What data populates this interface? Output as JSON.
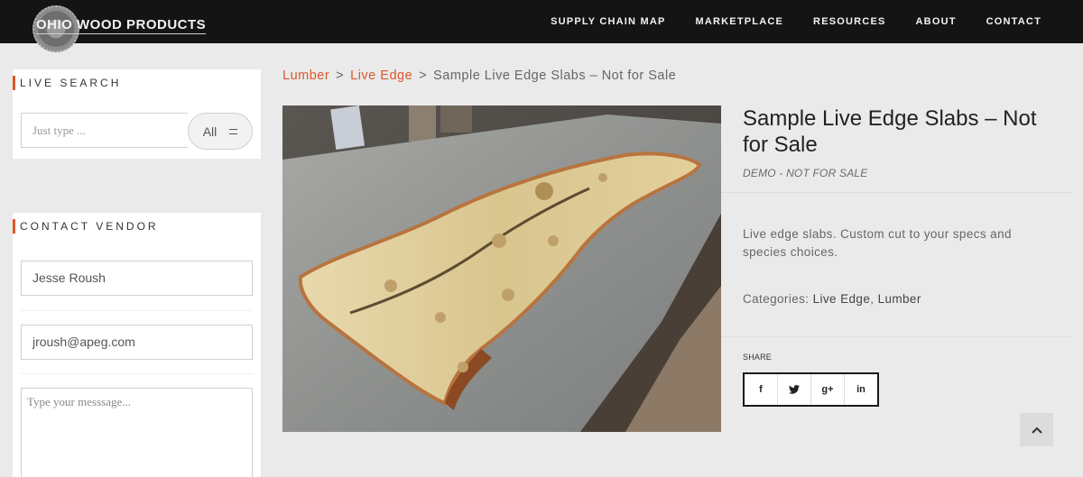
{
  "header": {
    "logo_text": "OHIO WOOD PRODUCTS",
    "nav": [
      "SUPPLY CHAIN MAP",
      "MARKETPLACE",
      "RESOURCES",
      "ABOUT",
      "CONTACT"
    ]
  },
  "sidebar": {
    "live_search": {
      "title": "LIVE SEARCH",
      "placeholder": "Just type ...",
      "filter_label": "All"
    },
    "contact_vendor": {
      "title": "CONTACT VENDOR",
      "name_value": "Jesse Roush",
      "email_value": "jroush@apeg.com",
      "message_placeholder": "Type your messsage..."
    }
  },
  "breadcrumb": {
    "items": [
      "Lumber",
      "Live Edge"
    ],
    "separator": ">",
    "current": "Sample Live Edge Slabs – Not for Sale"
  },
  "product": {
    "title": "Sample Live Edge Slabs – Not for Sale",
    "subtitle": "DEMO - NOT FOR SALE",
    "description": "Live edge slabs. Custom cut to your specs and species choices.",
    "categories_label": "Categories:",
    "categories": [
      "Live Edge",
      "Lumber"
    ],
    "categories_separator": ",",
    "share_label": "SHARE",
    "share_buttons": [
      "f",
      "t",
      "g+",
      "in"
    ]
  },
  "colors": {
    "accent": "#d9582b",
    "topbar": "#141414",
    "page_bg": "#eaeaea"
  }
}
